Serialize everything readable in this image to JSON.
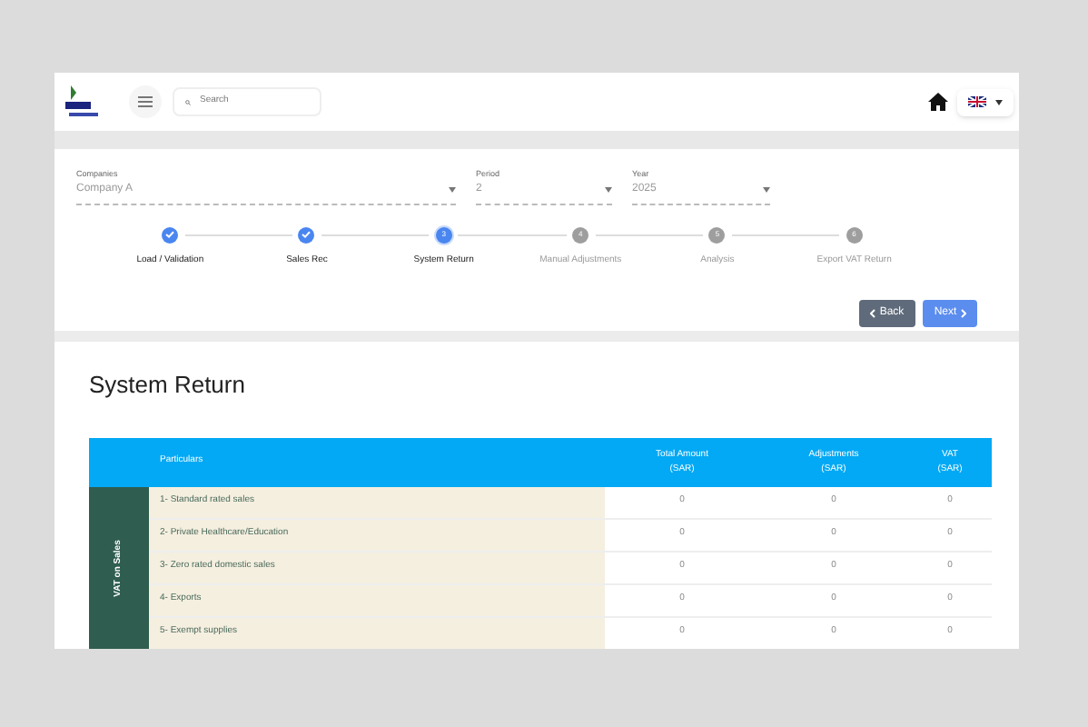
{
  "header": {
    "search": {
      "placeholder": "Search"
    }
  },
  "filters": [
    {
      "label": "Companies",
      "value": "Company A"
    },
    {
      "label": "Period",
      "value": "2"
    },
    {
      "label": "Year",
      "value": "2025"
    }
  ],
  "steps": [
    {
      "label": "Load / Validation",
      "completed": true,
      "selected": false
    },
    {
      "label": "Sales Rec",
      "completed": true,
      "selected": false
    },
    {
      "number": "3",
      "label": "System Return",
      "completed": false,
      "selected": true
    },
    {
      "number": "4",
      "label": "Manual Adjustments",
      "completed": false,
      "selected": false
    },
    {
      "number": "5",
      "label": "Analysis",
      "completed": false,
      "selected": false
    },
    {
      "number": "6",
      "label": "Export VAT Return",
      "completed": false,
      "selected": false
    }
  ],
  "buttons": {
    "back": "Back",
    "next": "Next"
  },
  "section_title": "System Return",
  "table": {
    "columns": [
      "Particulars",
      "Total Amount\n(SAR)",
      "Adjustments\n(SAR)",
      "VAT\n(SAR)"
    ],
    "group": "VAT on Sales",
    "rows": [
      {
        "particular": "1- Standard rated sales",
        "values": [
          "0",
          "0",
          "0"
        ]
      },
      {
        "particular": "2- Private Healthcare/Education",
        "values": [
          "0",
          "0",
          "0"
        ]
      },
      {
        "particular": "3- Zero rated domestic sales",
        "values": [
          "0",
          "0",
          "0"
        ]
      },
      {
        "particular": "4- Exports",
        "values": [
          "0",
          "0",
          "0"
        ]
      },
      {
        "particular": "5- Exempt supplies",
        "values": [
          "0",
          "0",
          "0"
        ]
      }
    ]
  }
}
